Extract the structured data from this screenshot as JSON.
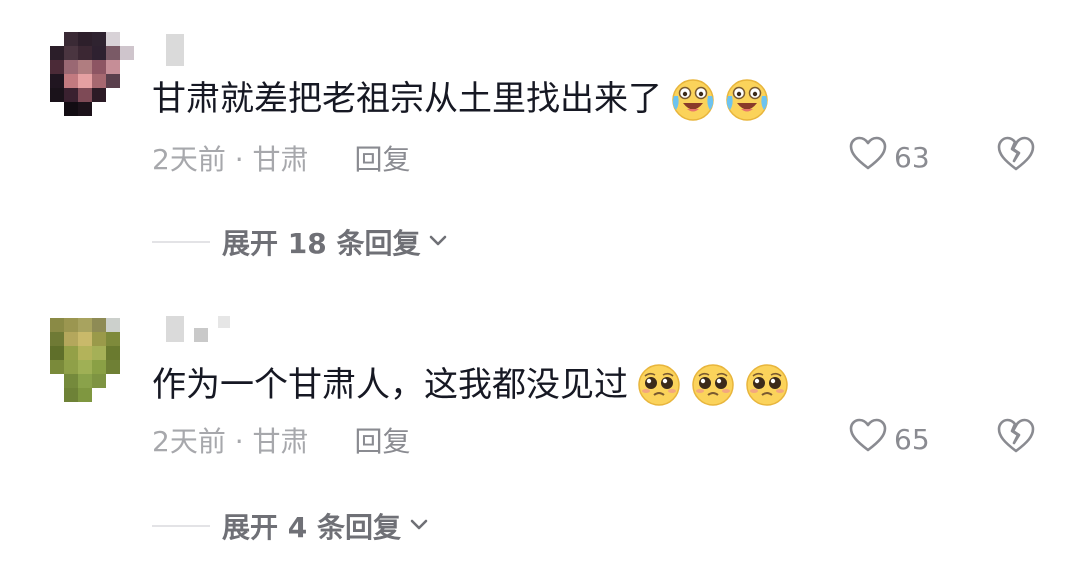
{
  "comments": [
    {
      "text": "甘肃就差把老祖宗从土里找出来了",
      "emojis": [
        "crying-laugh-emoji",
        "crying-laugh-emoji"
      ],
      "meta": "2天前 · 甘肃",
      "reply_label": "回复",
      "likes": "63",
      "expand_label": "展开 18 条回复",
      "avatar_colors": [
        "#ffffff",
        "#3a2a35",
        "#2d1f2b",
        "#2f2330",
        "#d8d2d7",
        "#ffffff",
        "#2b1e29",
        "#4a3540",
        "#3b2733",
        "#2e2130",
        "#7a5a66",
        "#cfc5cc",
        "#4b2a37",
        "#9a6873",
        "#b07d80",
        "#8d5563",
        "#c68e97",
        "#ffffff",
        "#201520",
        "#c27a80",
        "#e5a0a2",
        "#a66870",
        "#5a3f4c",
        "#ffffff",
        "#1a121a",
        "#3a2130",
        "#7e4a56",
        "#2c1b26",
        "#ffffff",
        "#ffffff",
        "#ffffff",
        "#120c12",
        "#1c121a",
        "#ffffff",
        "#ffffff",
        "#ffffff"
      ]
    },
    {
      "text": "作为一个甘肃人，这我都没见过",
      "emojis": [
        "pleading-face-emoji",
        "pleading-face-emoji",
        "pleading-face-emoji"
      ],
      "meta": "2天前 · 甘肃",
      "reply_label": "回复",
      "likes": "65",
      "expand_label": "展开 4 条回复",
      "avatar_colors": [
        "#8a8a45",
        "#9b9650",
        "#a8a35f",
        "#8e8b55",
        "#ccd0cc",
        "#ffffff",
        "#6f7a35",
        "#b4a75c",
        "#c9b96a",
        "#9a9a4a",
        "#7e8a3b",
        "#ffffff",
        "#5f6f2a",
        "#94a047",
        "#b3b35a",
        "#a5b057",
        "#6a7a2f",
        "#ffffff",
        "#7a8a3a",
        "#8fa048",
        "#9fb055",
        "#8aa045",
        "#6f8035",
        "#ffffff",
        "#ffffff",
        "#758a3c",
        "#8aa24a",
        "#7e9442",
        "#ffffff",
        "#ffffff",
        "#ffffff",
        "#6e8237",
        "#7f9740",
        "#ffffff",
        "#ffffff",
        "#ffffff"
      ]
    }
  ]
}
